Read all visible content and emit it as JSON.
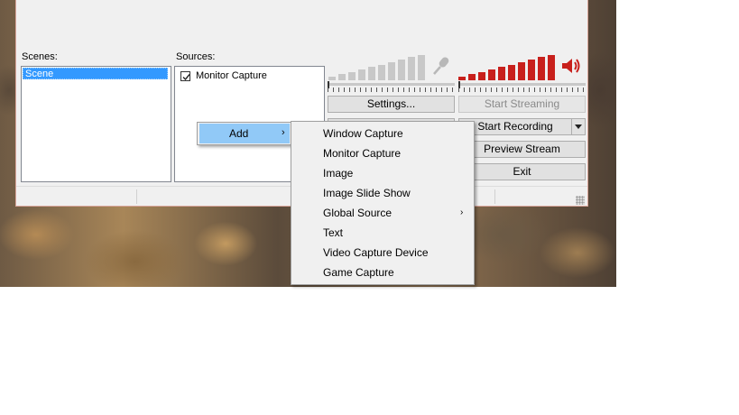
{
  "scenes": {
    "label": "Scenes:",
    "items": [
      "Scene"
    ]
  },
  "sources": {
    "label": "Sources:",
    "items": [
      {
        "label": "Monitor Capture",
        "checked": true
      }
    ]
  },
  "meters": {
    "mic": {
      "icon": "microphone-icon",
      "bar_color": "#c8c8c8"
    },
    "speaker": {
      "icon": "speaker-icon",
      "bar_color": "#c8201c"
    }
  },
  "buttons": {
    "settings": "Settings...",
    "start_streaming": "Start Streaming",
    "start_recording": "Start Recording",
    "preview_stream": "Preview Stream",
    "exit": "Exit"
  },
  "context_menu": {
    "add_label": "Add",
    "submenu": [
      "Window Capture",
      "Monitor Capture",
      "Image",
      "Image Slide Show",
      "Global Source",
      "Text",
      "Video Capture Device",
      "Game Capture"
    ]
  },
  "colors": {
    "selection": "#3399ff",
    "menu_highlight": "#91c9f7",
    "window_bg": "#f0f0f0"
  }
}
